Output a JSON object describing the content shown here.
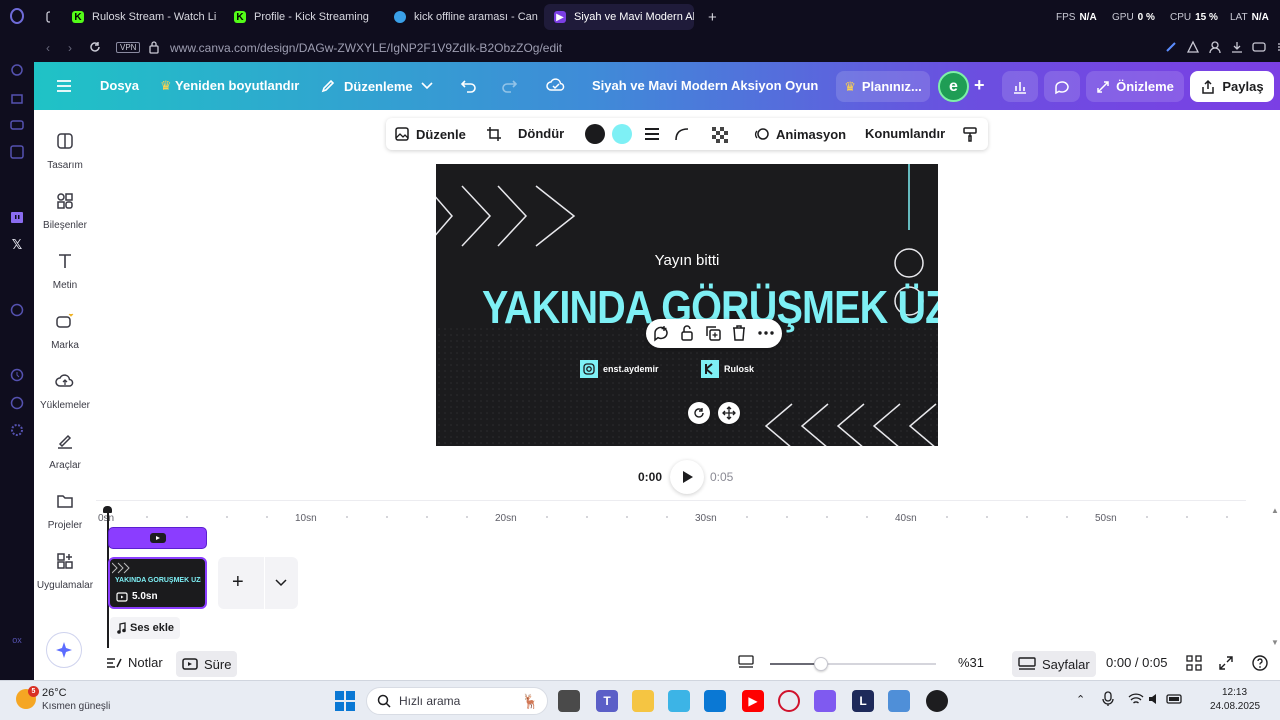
{
  "browser": {
    "tabs": [
      {
        "label": "Rulosk Stream - Watch Li",
        "icon": "kick-icon"
      },
      {
        "label": "Profile - Kick Streaming",
        "icon": "kick-icon"
      },
      {
        "label": "kick offline araması - Can",
        "icon": "canva-icon"
      },
      {
        "label": "Siyah ve Mavi Modern Ak",
        "icon": "canva-video-icon",
        "active": true
      }
    ],
    "stats": {
      "fps_label": "FPS",
      "fps_value": "N/A",
      "gpu_label": "GPU",
      "gpu_value": "0 %",
      "cpu_label": "CPU",
      "cpu_value": "15 %",
      "lat_label": "LAT",
      "lat_value": "N/A"
    },
    "vpn": "VPN",
    "url": "www.canva.com/design/DAGw-ZWXYLE/IgNP2F1V9ZdIk-B2ObzZOg/edit"
  },
  "header": {
    "file": "Dosya",
    "resize": "Yeniden boyutlandır",
    "edit": "Düzenleme",
    "doc_title": "Siyah ve Mavi Modern Aksiyon Oyun ...",
    "plan": "Planınız...",
    "avatar_letter": "e",
    "preview": "Önizleme",
    "share": "Paylaş"
  },
  "sidebar": {
    "items": [
      {
        "label": "Tasarım",
        "icon": "layout-icon"
      },
      {
        "label": "Bileşenler",
        "icon": "shapes-icon"
      },
      {
        "label": "Metin",
        "icon": "text-icon"
      },
      {
        "label": "Marka",
        "icon": "brand-icon"
      },
      {
        "label": "Yüklemeler",
        "icon": "upload-cloud-icon"
      },
      {
        "label": "Araçlar",
        "icon": "draw-icon"
      },
      {
        "label": "Projeler",
        "icon": "folder-icon"
      },
      {
        "label": "Uygulamalar",
        "icon": "apps-icon"
      }
    ]
  },
  "toolbar": {
    "edit": "Düzenle",
    "rotate": "Döndür",
    "animation": "Animasyon",
    "position": "Konumlandır",
    "color1": "#1b1b1d",
    "color2": "#7ef0f5"
  },
  "design": {
    "subtitle": "Yayın bitti",
    "title": "YAKINDA GÖRÜŞMEK ÜZERE",
    "instagram": "enst.aydemir",
    "kick": "Rulosk"
  },
  "player": {
    "current": "0:00",
    "total": "0:05"
  },
  "timeline": {
    "ticks": [
      "0sn",
      "10sn",
      "20sn",
      "30sn",
      "40sn",
      "50sn"
    ],
    "clip_duration": "5.0sn",
    "add_audio": "Ses ekle"
  },
  "bottom": {
    "notes": "Notlar",
    "duration": "Süre",
    "zoom": "%31",
    "zoom_level": 0.31,
    "pages": "Sayfalar",
    "time": "0:00 / 0:05"
  },
  "taskbar": {
    "weather_temp": "26°C",
    "weather_desc": "Kısmen güneşli",
    "notif": "5",
    "search_placeholder": "Hızlı arama",
    "time": "12:13",
    "date": "24.08.2025"
  }
}
